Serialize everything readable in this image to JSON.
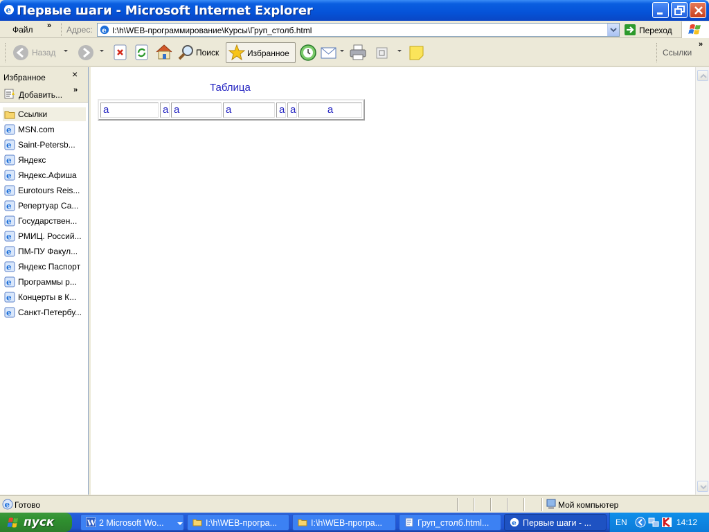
{
  "window": {
    "title": "Первые шаги - Microsoft Internet Explorer"
  },
  "menubar": {
    "file_label": "Файл",
    "address_label": "Адрес:",
    "address_value": "I:\\h\\WEB-программирование\\Курсы\\Груп_столб.html",
    "go_label": "Переход"
  },
  "toolbar": {
    "back_label": "Назад",
    "search_label": "Поиск",
    "favorites_label": "Избранное",
    "links_label": "Ссылки"
  },
  "favorites": {
    "title": "Избранное",
    "add_label": "Добавить...",
    "folder_label": "Ссылки",
    "items": [
      "MSN.com",
      "Saint-Petersb...",
      "Яндекс",
      "Яндекс.Афиша",
      "Eurotours Reis...",
      "Репертуар Са...",
      "Государствен...",
      "РМИЦ. Россий...",
      "ПМ-ПУ  Факул...",
      "Яндекс Паспорт",
      "Программы р...",
      "Концерты в К...",
      "Санкт-Петербу..."
    ]
  },
  "page": {
    "caption": "Таблица",
    "cells": [
      "a",
      "a",
      "a",
      "a",
      "a",
      "a",
      "a"
    ]
  },
  "statusbar": {
    "status": "Готово",
    "zone": "Мой компьютер"
  },
  "taskbar": {
    "start_label": "пуск",
    "tasks": [
      "2 Microsoft Wo...",
      "I:\\h\\WEB-програ...",
      "I:\\h\\WEB-програ...",
      "Груп_столб.html...",
      "Первые шаги - ..."
    ],
    "lang": "EN",
    "clock": "14:12"
  }
}
